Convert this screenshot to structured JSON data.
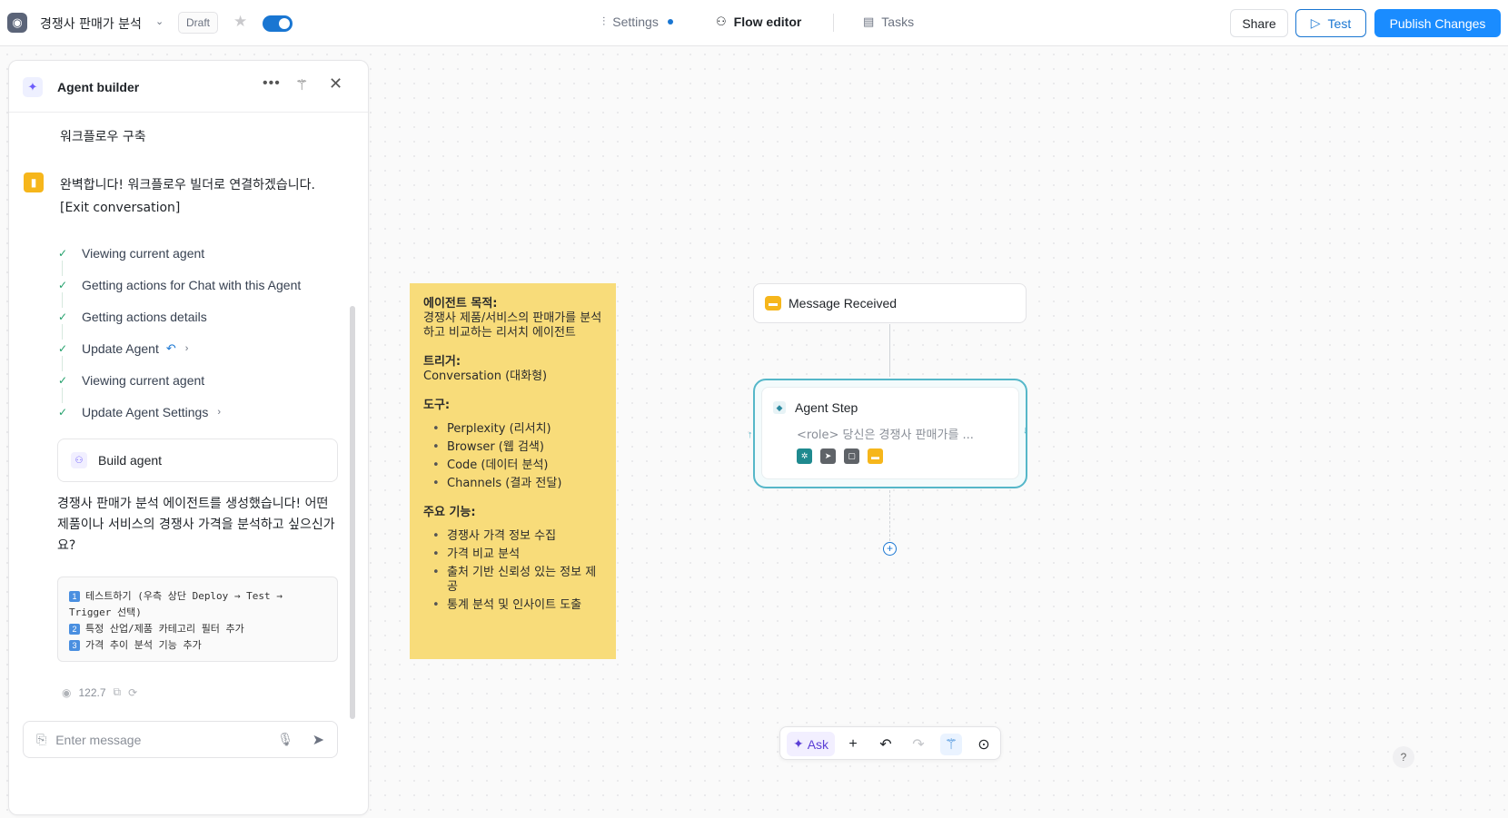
{
  "header": {
    "agent_name": "경쟁사 판매가 분석",
    "status_badge": "Draft",
    "nav": {
      "settings": "Settings",
      "flow_editor": "Flow editor",
      "tasks": "Tasks"
    },
    "share_label": "Share",
    "test_label": "Test",
    "publish_label": "Publish Changes"
  },
  "panel": {
    "title": "Agent builder",
    "user_message": "워크플로우 구축",
    "bot_message_line1": "완벽합니다! 워크플로우 빌더로 연결하겠습니다.",
    "bot_message_line2": "[Exit conversation]",
    "steps": [
      {
        "label": "Viewing current agent"
      },
      {
        "label": "Getting actions for Chat with this Agent"
      },
      {
        "label": "Getting actions details"
      },
      {
        "label": "Update Agent"
      },
      {
        "label": "Viewing current agent"
      },
      {
        "label": "Update Agent Settings"
      }
    ],
    "build_card_label": "Build agent",
    "result_message": "경쟁사 판매가 분석 에이전트를 생성했습니다! 어떤 제품이나 서비스의 경쟁사 가격을 분석하고 싶으신가요?",
    "suggestions": [
      {
        "num": "1",
        "text": "테스트하기 (우측 상단 Deploy → Test → Trigger 선택)"
      },
      {
        "num": "2",
        "text": "특정 산업/제품 카테고리 필터 추가"
      },
      {
        "num": "3",
        "text": "가격 추이 분석 기능 추가"
      }
    ],
    "credits": "122.7",
    "input_placeholder": "Enter message"
  },
  "note": {
    "purpose_title": "에이전트 목적:",
    "purpose_text": "경쟁사 제품/서비스의 판매가를 분석하고 비교하는 리서치 에이전트",
    "trigger_title": "트리거:",
    "trigger_text": "Conversation (대화형)",
    "tools_title": "도구:",
    "tools": [
      "Perplexity (리서치)",
      "Browser (웹 검색)",
      "Code (데이터 분석)",
      "Channels (결과 전달)"
    ],
    "features_title": "주요 기능:",
    "features": [
      "경쟁사 가격 정보 수집",
      "가격 비교 분석",
      "출처 기반 신뢰성 있는 정보 제공",
      "통계 분석 및 인사이트 도출"
    ]
  },
  "flow": {
    "trigger_node": "Message Received",
    "agent_node_title": "Agent Step",
    "agent_node_desc": "<role> 당신은 경쟁사 판매가를 ...",
    "tool_colors": [
      "#1f8a8f",
      "#5f6368",
      "#5f6368",
      "#f6b61b"
    ]
  },
  "toolbar": {
    "ask_label": "Ask"
  },
  "help_label": "?"
}
